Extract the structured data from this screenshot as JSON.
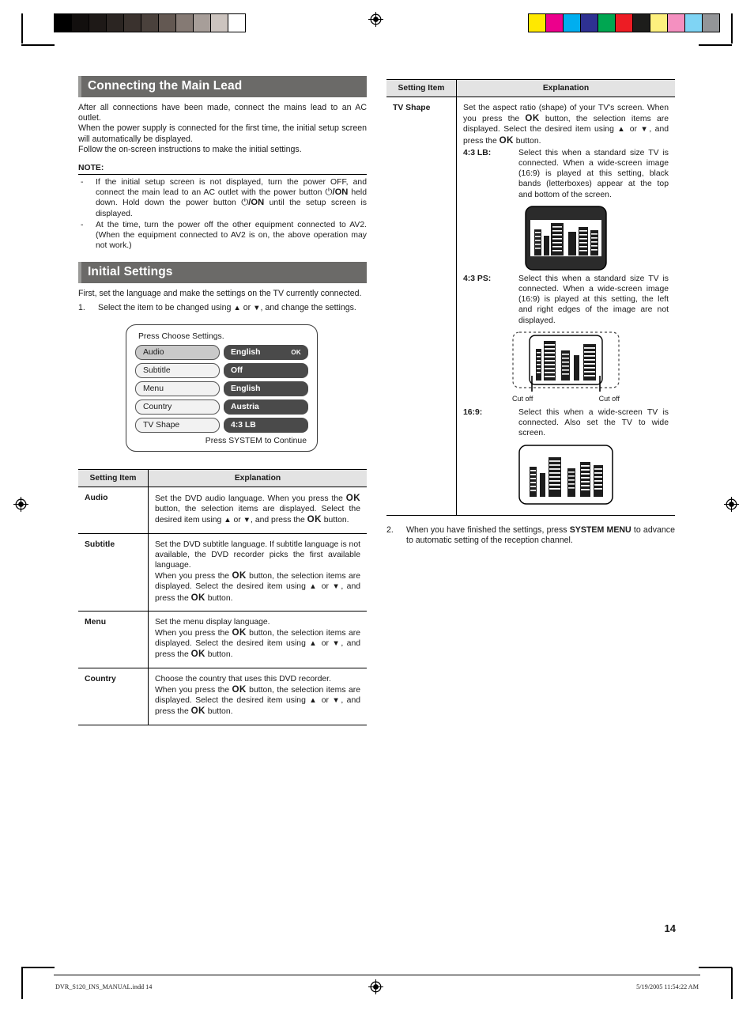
{
  "print_marks": {
    "gray_strip": {
      "name": "grayscale-calibration-strip",
      "swatches": [
        "#000000",
        "#120f0e",
        "#1e1917",
        "#2b2522",
        "#3a322e",
        "#4a413c",
        "#635852",
        "#857a74",
        "#a79e99",
        "#ccc4bf",
        "#ffffff"
      ]
    },
    "color_strip": {
      "name": "color-registration-strip",
      "swatches": [
        "#ffe800",
        "#ec008c",
        "#00aeef",
        "#2e3192",
        "#00a651",
        "#ed1c24",
        "#1d1d1b",
        "#fdf07e",
        "#f490c0",
        "#7fd4f4",
        "#939598"
      ]
    }
  },
  "left_column": {
    "section1": {
      "heading": "Connecting the Main Lead",
      "paragraphs": [
        "After all connections have been made, connect the mains lead to an AC outlet.",
        "When the power supply is connected for the first time, the initial setup screen will automatically be displayed.",
        "Follow the on-screen instructions to make the initial settings."
      ],
      "note_label": "NOTE:",
      "notes": [
        {
          "dash": "-",
          "part1": "If the initial setup screen is not displayed, turn the power OFF, and connect the main lead to an AC outlet with the power button ",
          "power1": "⏻",
          "on1": "/ON",
          "part2": " held down. Hold down the power button ",
          "power2": "⏻",
          "on2": "/ON",
          "part3": " until the setup screen is displayed."
        },
        {
          "dash": "-",
          "text": "At the time, turn the power off the other equipment connected to AV2. (When the equipment connected to AV2 is on, the above operation may not work.)"
        }
      ]
    },
    "section2": {
      "heading": "Initial Settings",
      "intro": "First, set the language and make the settings on the TV currently connected.",
      "step1": {
        "num": "1.",
        "pre": "Select the item to be changed using ",
        "up": "▲",
        "mid": " or ",
        "down": "▼",
        "post": ", and change the settings."
      }
    },
    "osd": {
      "title": "Press Choose Settings.",
      "rows": [
        {
          "key": "Audio",
          "value": "English",
          "ok_tag": "OK",
          "selected": true
        },
        {
          "key": "Subtitle",
          "value": "Off",
          "ok_tag": "",
          "selected": false
        },
        {
          "key": "Menu",
          "value": "English",
          "ok_tag": "",
          "selected": false
        },
        {
          "key": "Country",
          "value": "Austria",
          "ok_tag": "",
          "selected": false
        },
        {
          "key": "TV Shape",
          "value": "4:3 LB",
          "ok_tag": "",
          "selected": false
        }
      ],
      "footer": "Press SYSTEM to Continue"
    },
    "table": {
      "headers": {
        "col1": "Setting Item",
        "col2": "Explanation"
      },
      "rows": [
        {
          "item": "Audio",
          "segments": [
            {
              "t": "Set the DVD audio language. When you press the "
            },
            {
              "t": "OK",
              "k": "ok"
            },
            {
              "t": " button, the selection items are displayed. Select the desired item using "
            },
            {
              "t": "▲",
              "k": "arrow"
            },
            {
              "t": " or "
            },
            {
              "t": "▼",
              "k": "arrow"
            },
            {
              "t": ", and press the "
            },
            {
              "t": "OK",
              "k": "ok"
            },
            {
              "t": " button."
            }
          ]
        },
        {
          "item": "Subtitle",
          "segments": [
            {
              "t": "Set the DVD subtitle language. If subtitle language is not available, the DVD recorder picks the first available language."
            },
            {
              "t": "\n",
              "k": "br"
            },
            {
              "t": "When you press the "
            },
            {
              "t": "OK",
              "k": "ok"
            },
            {
              "t": " button, the selection items are displayed. Select the desired item using "
            },
            {
              "t": "▲",
              "k": "arrow"
            },
            {
              "t": " or "
            },
            {
              "t": "▼",
              "k": "arrow"
            },
            {
              "t": ", and press the "
            },
            {
              "t": "OK",
              "k": "ok"
            },
            {
              "t": " button."
            }
          ]
        },
        {
          "item": "Menu",
          "segments": [
            {
              "t": "Set the menu display language."
            },
            {
              "t": "\n",
              "k": "br"
            },
            {
              "t": "When you press the "
            },
            {
              "t": "OK",
              "k": "ok"
            },
            {
              "t": " button, the selection items are displayed. Select the desired item using "
            },
            {
              "t": "▲",
              "k": "arrow"
            },
            {
              "t": " or "
            },
            {
              "t": "▼",
              "k": "arrow"
            },
            {
              "t": ", and press the "
            },
            {
              "t": "OK",
              "k": "ok"
            },
            {
              "t": " button."
            }
          ]
        },
        {
          "item": "Country",
          "segments": [
            {
              "t": "Choose the country that uses this DVD recorder."
            },
            {
              "t": "\n",
              "k": "br"
            },
            {
              "t": "When you press the "
            },
            {
              "t": "OK",
              "k": "ok"
            },
            {
              "t": " button, the selection items are displayed. Select the desired item using "
            },
            {
              "t": "▲",
              "k": "arrow"
            },
            {
              "t": " or "
            },
            {
              "t": "▼",
              "k": "arrow"
            },
            {
              "t": ", and press the "
            },
            {
              "t": "OK",
              "k": "ok"
            },
            {
              "t": " button."
            }
          ]
        }
      ]
    }
  },
  "right_column": {
    "table": {
      "headers": {
        "col1": "Setting Item",
        "col2": "Explanation"
      },
      "item": "TV Shape",
      "intro_segments": [
        {
          "t": "Set the aspect ratio (shape) of your TV's screen. When you press the "
        },
        {
          "t": "OK",
          "k": "ok"
        },
        {
          "t": " button, the selection items are displayed. Select the desired item using "
        },
        {
          "t": "▲",
          "k": "arrow"
        },
        {
          "t": " or "
        },
        {
          "t": "▼",
          "k": "arrow"
        },
        {
          "t": ", and press the "
        },
        {
          "t": "OK",
          "k": "ok"
        },
        {
          "t": " button."
        }
      ],
      "definitions": [
        {
          "term": "4:3 LB:",
          "text": "Select this when a standard size TV is connected. When a wide-screen image (16:9) is played at this setting, black bands (letterboxes) appear at the top and bottom of the screen.",
          "figure": "letterbox-tv-figure"
        },
        {
          "term": "4:3 PS:",
          "text": "Select this when a standard size TV is connected. When a wide-screen image (16:9) is played at this setting, the left and right edges of the image are not displayed.",
          "figure": "pan-scan-tv-figure",
          "cutoff_left": "Cut off",
          "cutoff_right": "Cut off"
        },
        {
          "term": "16:9:",
          "text": "Select this when a wide-screen TV is connected. Also set the TV to wide screen.",
          "figure": "widescreen-tv-figure"
        }
      ]
    },
    "step2": {
      "num": "2.",
      "pre": "When you have finished the settings, press ",
      "strong": "SYSTEM MENU",
      "post": " to advance to automatic setting of the reception channel."
    }
  },
  "page_number": "14",
  "footer": {
    "file": "DVR_S120_INS_MANUAL.indd   14",
    "date": "5/19/2005   11:54:22 AM"
  }
}
